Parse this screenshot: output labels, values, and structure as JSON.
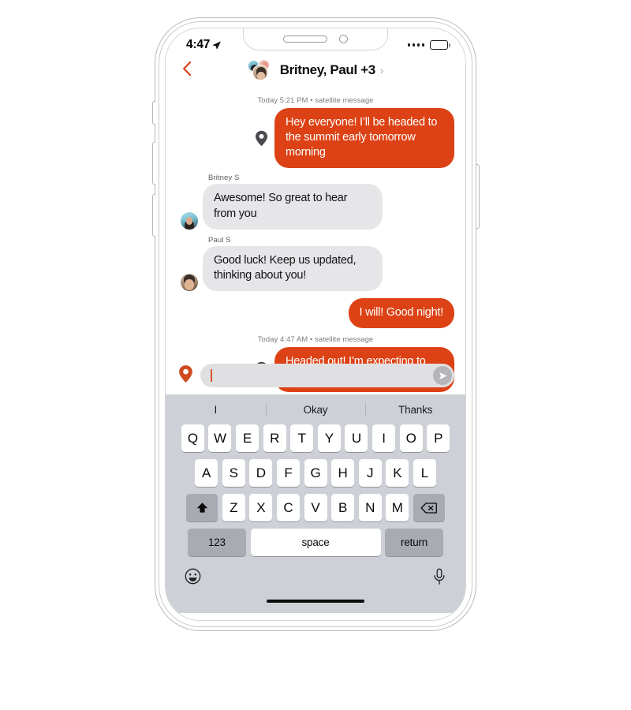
{
  "status_bar": {
    "time": "4:47",
    "location_icon": "location-arrow-icon",
    "cellular_icon": "signal-dots-icon",
    "battery_icon": "battery-full-icon"
  },
  "chat_header": {
    "back_icon": "back-chevron-icon",
    "title": "Britney, Paul +3",
    "disclosure": "›",
    "avatars": [
      "avatar-britney",
      "avatar-extra",
      "avatar-paul"
    ]
  },
  "conversation": {
    "timestamps": [
      "Today 5:21 PM • satellite message",
      "Today 4:47 AM • satellite message"
    ],
    "messages": [
      {
        "id": "msg-1",
        "direction": "sent",
        "via_satellite": true,
        "pin_icon": "location-pin-icon",
        "text": "Hey everyone! I’ll be headed to the summit early tomorrow morning"
      },
      {
        "id": "msg-2",
        "direction": "received",
        "sender": "Britney S",
        "avatar": "avatar-britney",
        "text": "Awesome! So great to hear from you"
      },
      {
        "id": "msg-3",
        "direction": "received",
        "sender": "Paul S",
        "avatar": "avatar-paul",
        "text": "Good luck! Keep us updated, thinking about you!"
      },
      {
        "id": "msg-4",
        "direction": "sent",
        "via_satellite": false,
        "text": "I will! Good night!"
      },
      {
        "id": "msg-5",
        "direction": "sent",
        "via_satellite": true,
        "pin_icon": "location-pin-icon",
        "text": "Headed out! I’m expecting to reach the summit around noon"
      }
    ]
  },
  "compose": {
    "pin_icon": "location-pin-icon",
    "input_value": "",
    "placeholder": "",
    "send_icon": "send-arrow-icon"
  },
  "keyboard": {
    "suggestions": [
      "I",
      "Okay",
      "Thanks"
    ],
    "row1": [
      "Q",
      "W",
      "E",
      "R",
      "T",
      "Y",
      "U",
      "I",
      "O",
      "P"
    ],
    "row2": [
      "A",
      "S",
      "D",
      "F",
      "G",
      "H",
      "J",
      "K",
      "L"
    ],
    "row3": [
      "Z",
      "X",
      "C",
      "V",
      "B",
      "N",
      "M"
    ],
    "shift_icon": "shift-arrow-icon",
    "backspace_icon": "backspace-icon",
    "numbers_label": "123",
    "space_label": "space",
    "return_label": "return",
    "emoji_icon": "emoji-smiley-icon",
    "dictation_icon": "microphone-icon"
  },
  "colors": {
    "sent_bubble": "#dc4215",
    "received_bubble": "#e6e6e8",
    "accent": "#d8552d",
    "keyboard_bg": "#ced0d7",
    "key_bg": "#ffffff",
    "key_modifier_bg": "#a9abb3"
  }
}
